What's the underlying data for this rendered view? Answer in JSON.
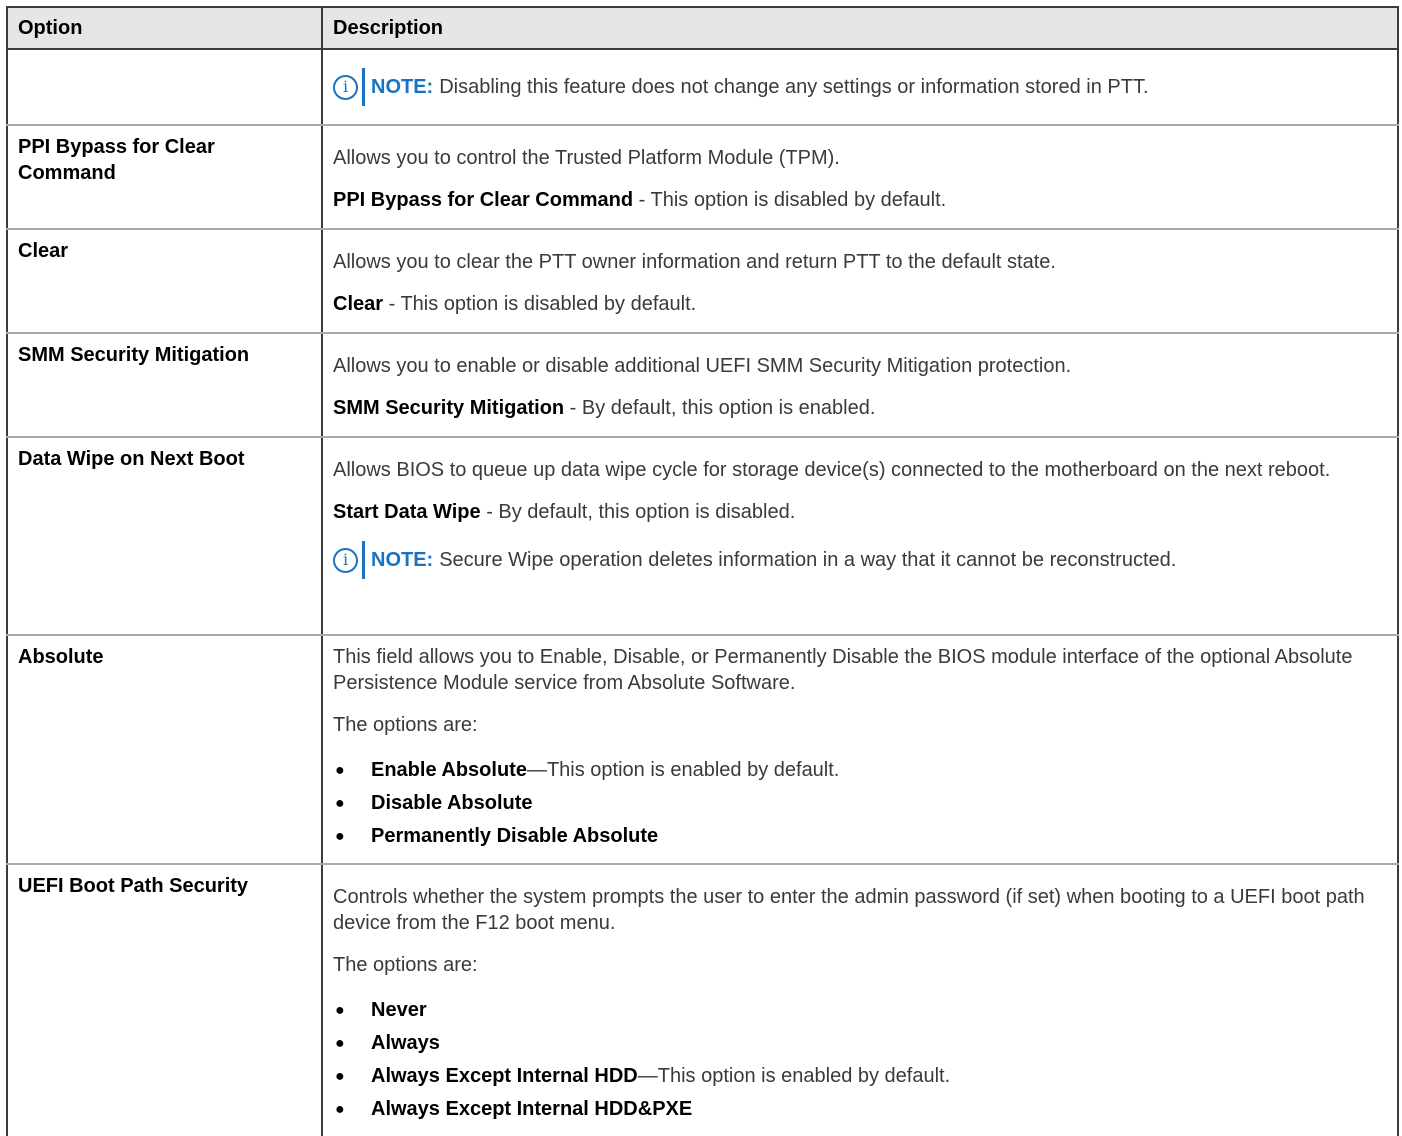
{
  "header": {
    "option": "Option",
    "description": "Description"
  },
  "note_label": "NOTE:",
  "rows": [
    {
      "option": "",
      "note": "Disabling this feature does not change any settings or information stored in PTT."
    },
    {
      "option": "PPI Bypass for Clear Command",
      "desc": "Allows you to control the Trusted Platform Module (TPM).",
      "setting_name": "PPI Bypass for Clear Command",
      "setting_text": " - This option is disabled by default."
    },
    {
      "option": "Clear",
      "desc": "Allows you to clear the PTT owner information and return PTT to the default state.",
      "setting_name": "Clear",
      "setting_text": " - This option is disabled by default."
    },
    {
      "option": "SMM Security Mitigation",
      "desc": "Allows you to enable or disable additional UEFI SMM Security Mitigation protection.",
      "setting_name": "SMM Security Mitigation",
      "setting_text": " - By default, this option is enabled."
    },
    {
      "option": "Data Wipe on Next Boot",
      "desc": "Allows BIOS to queue up data wipe cycle for storage device(s) connected to the motherboard on the next reboot.",
      "setting_name": "Start Data Wipe",
      "setting_text": " - By default, this option is disabled.",
      "note": "Secure Wipe operation deletes information in a way that it cannot be reconstructed."
    },
    {
      "option": "Absolute",
      "desc": "This field allows you to Enable, Disable, or Permanently Disable the BIOS module interface of the optional Absolute Persistence Module service from Absolute Software.",
      "options_intro": "The options are:",
      "items": [
        {
          "name": "Enable Absolute",
          "suffix": "—This option is enabled by default."
        },
        {
          "name": "Disable Absolute",
          "suffix": ""
        },
        {
          "name": "Permanently Disable Absolute",
          "suffix": ""
        }
      ]
    },
    {
      "option": "UEFI Boot Path Security",
      "desc": "Controls whether the system prompts the user to enter the admin password (if set) when booting to a UEFI boot path device from the F12 boot menu.",
      "options_intro": "The options are:",
      "items": [
        {
          "name": "Never",
          "suffix": ""
        },
        {
          "name": "Always",
          "suffix": ""
        },
        {
          "name": "Always Except Internal HDD",
          "suffix": "—This option is enabled by default."
        },
        {
          "name": "Always Except Internal HDD&PXE",
          "suffix": ""
        }
      ]
    }
  ]
}
